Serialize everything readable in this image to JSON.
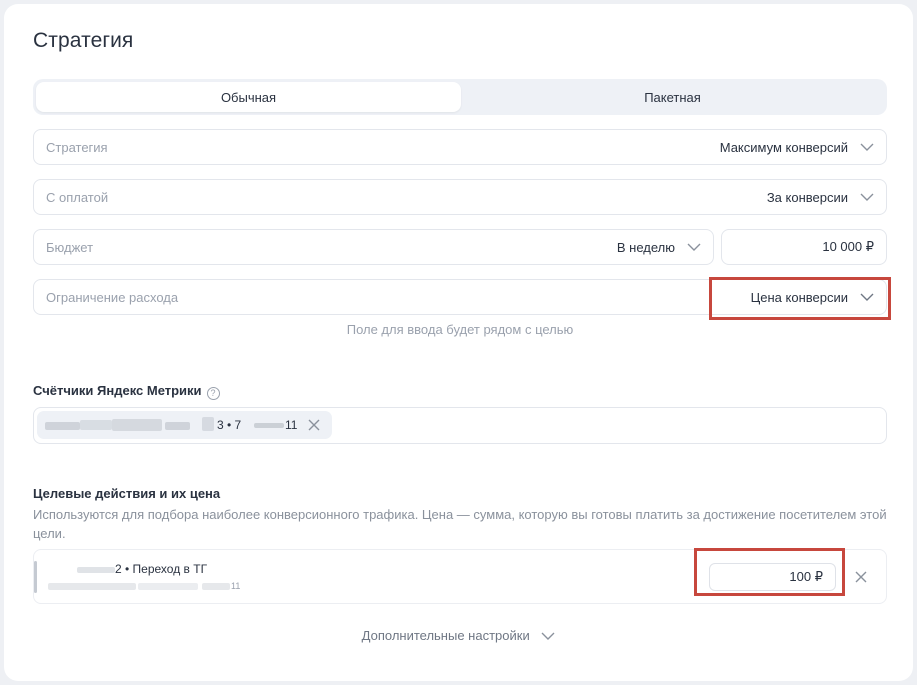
{
  "page": {
    "title": "Стратегия"
  },
  "tabs": [
    {
      "label": "Обычная",
      "active": true
    },
    {
      "label": "Пакетная",
      "active": false
    }
  ],
  "fields": {
    "strategy": {
      "label": "Стратегия",
      "value": "Максимум конверсий"
    },
    "payment": {
      "label": "С оплатой",
      "value": "За конверсии"
    },
    "budget": {
      "label": "Бюджет",
      "period": "В неделю",
      "amount": "10 000  ₽"
    },
    "limit": {
      "label": "Ограничение расхода",
      "value": "Цена конверсии"
    }
  },
  "hint": "Поле для ввода будет рядом с целью",
  "counters": {
    "title": "Счётчики Яндекс Метрики",
    "help_icon": "?",
    "chip_text": "3 • 7",
    "chip_suffix": "11"
  },
  "goals": {
    "title": "Целевые действия и их цена",
    "description": "Используются для подбора наиболее конверсионного трафика. Цена — сумма, которую вы готовы платить за достижение посетителем этой цели.",
    "row": {
      "name_suffix": "2 • Переход в ТГ",
      "sub_suffix": "11",
      "price": "100  ₽"
    }
  },
  "more_settings": "Дополнительные настройки",
  "colors": {
    "highlight": "#c7473d",
    "accent_bg": "#eef1f6"
  }
}
